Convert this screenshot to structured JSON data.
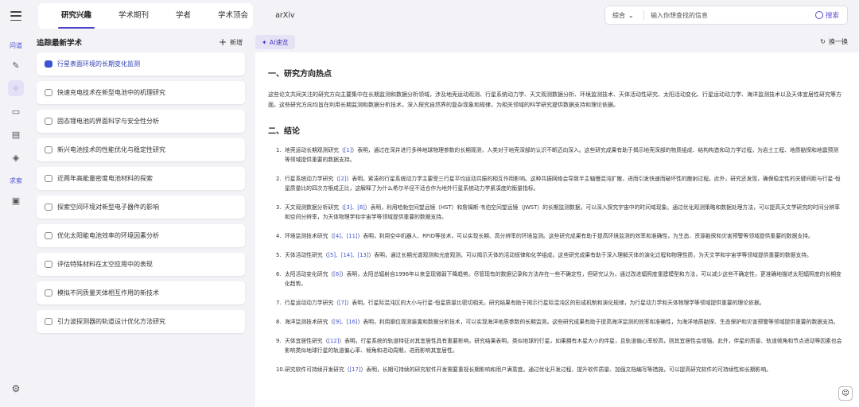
{
  "rail": {
    "label_ask": "问道",
    "label_search": "求索"
  },
  "tabs": [
    "研究兴趣",
    "学术期刊",
    "学者",
    "学术顶会",
    "arXiv"
  ],
  "search": {
    "scope": "综合",
    "placeholder": "输入你想查找的信息",
    "button": "搜索"
  },
  "list": {
    "title": "追踪最新学术",
    "add_label": "新增",
    "items": [
      "行星表面环境的长期变化监测",
      "快速充电技术在新型电池中的机理研究",
      "固态锂电池的界面科学与安全性分析",
      "新兴电池技术的性能优化与稳定性研究",
      "近两年高能量密度电池材料的探索",
      "探索空间环境对新型电子器件的影响",
      "优化太阳能电池效率的环境因素分析",
      "评估特殊材料在太空应用中的表现",
      "模拟不同质量天体相互作用的新技术",
      "引力波探测器的轨道设计优化方法研究"
    ]
  },
  "main": {
    "ai_label": "AI速览",
    "switch_label": "换一换",
    "sec1_title": "一、研究方向热点",
    "intro": "这些论文共同关注的研究方向主要集中在长期监测和数据分析领域，涉及地壳运动观测、行星系统动力学、天文观测数据分析、环境监测技术、天体活动性研究、太阳活动变化、行星运动动力学、海洋监测技术以及天体宜居性研究等方面。这些研究方向均旨在利用长期监测和数据分析技术，深入探究自然界的复杂现象和规律，为相关领域的科学研究提供数据支持和理论依据。",
    "sec2_title": "二、结论",
    "conclusions": [
      {
        "num": "1.",
        "lead": "地壳运动长期观测研究（",
        "refs": "[1]",
        "tail": "）表明，通过在深井进行多种地球物理参数的长期观测，人类对于地壳深部的认识不断迈向深入。这些研究成果有助于揭示地壳深部的物质组成、结构构造和动力学过程，为岩土工程、地质勘探和地震预测等领域提供重要的数据支持。"
      },
      {
        "num": "2.",
        "lead": "行星系统动力学研究（",
        "refs": "[2]",
        "tail": "）表明，紧凑的行星系统动力学主要受三行星平均运动共振的相互作用影响。这种共振网络会导致半主轴慢混沌扩散，进而引发快速而破坏性的散射过程。此外，研究还发现，确保稳定性的关键间距与行星-恒星质量比的四次方根成正比，这解释了为什么希尔半径不适合作为地外行星系统动力学紧凑度的衡量指标。"
      },
      {
        "num": "3.",
        "lead": "天文观测数据分析研究（",
        "refs": "[3]、[8]",
        "tail": "）表明，利用哈勃空间望远镜（HST）和詹姆斯·韦伯空间望远镜（JWST）的长期监测数据，可以深入探究宇宙中的时间域现象。通过优化观测策略和数据处理方法，可以提高天文学研究的时间分辨率和空间分辨率，为天体物理学和宇宙学等领域提供重要的数据支持。"
      },
      {
        "num": "4.",
        "lead": "环境监测技术研究（",
        "refs": "[4]、[11]",
        "tail": "）表明，利用空中机器人、RFID等技术，可以实现长期、高分辨率的环境监测。这些研究成果有助于提高环境监测的效率和准确性，为生态、资源勘探和灾害预警等领域提供重要的数据支持。"
      },
      {
        "num": "5.",
        "lead": "天体活动性研究（",
        "refs": "[5]、[14]、[13]",
        "tail": "）表明，通过长期光谱观测和光度观测，可以揭示天体的活动规律和化学组成。这些研究成果有助于深入理解天体的演化过程和物理性质，为天文学和宇宙学等领域提供重要的数据支持。"
      },
      {
        "num": "6.",
        "lead": "太阳活动变化研究（",
        "refs": "[6]",
        "tail": "）表明，太阳总辐射自1996年以来呈现微弱下降趋势。尽管现有的数据记录和方法存在一些不确定性，但研究认为，通过改进辐照度重建模型和方法，可以减少这些不确定性，更准确地描述太阳辐照度的长期变化趋势。"
      },
      {
        "num": "7.",
        "lead": "行星运动动力学研究（",
        "refs": "[7]",
        "tail": "）表明，行星际混沌区的大小与行星-恒星质量比密切相关。研究结果有助于揭示行星际混沌区的形成机制和演化规律，为行星动力学和天体物理学等领域提供重要的理论依据。"
      },
      {
        "num": "8.",
        "lead": "海洋监测技术研究（",
        "refs": "[9]、[16]",
        "tail": "）表明，利用廓位观测装置和数据分析技术，可以实现海洋地质参数的长期监测。这些研究成果有助于提高海洋监测的效率和准确性，为海洋地质勘探、生态保护和灾害预警等领域提供重要的数据支持。"
      },
      {
        "num": "9.",
        "lead": "天体宜居性研究（",
        "refs": "[12]",
        "tail": "）表明，行星系统的轨道特征对其宜居性具有重要影响。研究结果表明，类似地球的行星，如果拥有木星大小的伴星，且轨道偏心率较高，则其宜居性会增强。此外，伴星的质量、轨道倾角和节点进动等因素也会影响类似地球行星的轨道偏心率、倾角和进动周期，进而影响其宜居性。"
      },
      {
        "num": "10.",
        "lead": "研究软件可持续开发研究（",
        "refs": "[17]",
        "tail": "）表明，长期可持续的研究软件开发需要重视长期影响和用户满意度。通过优化开发过程、提升软件质量、加强文档编写等措施，可以提高研究软件的可持续性和长期影响。"
      }
    ]
  }
}
